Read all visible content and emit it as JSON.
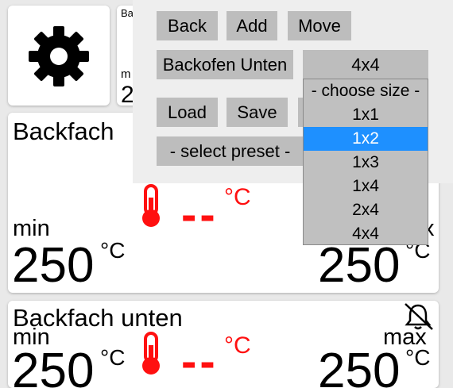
{
  "tiles": {
    "small_card": {
      "line1": "Ba",
      "line2": "m",
      "line3": "2"
    }
  },
  "zone1": {
    "title": "Backfach",
    "min_label": "min",
    "min_value": "250",
    "max_value": "250",
    "unit": "°C",
    "current_value": "--",
    "current_unit": "°C",
    "partial_max": "x"
  },
  "zone2": {
    "title": "Backfach unten",
    "min_label": "min",
    "max_label": "max",
    "min_value": "250",
    "max_value": "250",
    "unit": "°C",
    "current_value": "--",
    "current_unit": "°C"
  },
  "panel": {
    "back_label": "Back",
    "add_label": "Add",
    "move_label": "Move",
    "name_label": "Backofen Unten",
    "size_value": "4x4",
    "load_label": "Load",
    "save_label": "Save",
    "preset_label": "- select preset -"
  },
  "size_dropdown": {
    "options": [
      "- choose size -",
      "1x1",
      "1x2",
      "1x3",
      "1x4",
      "2x4",
      "4x4"
    ],
    "highlighted": "1x2"
  },
  "colors": {
    "accent_red": "#ff1010",
    "highlight_blue": "#1e90ff",
    "button_gray": "#bdbdbd"
  }
}
